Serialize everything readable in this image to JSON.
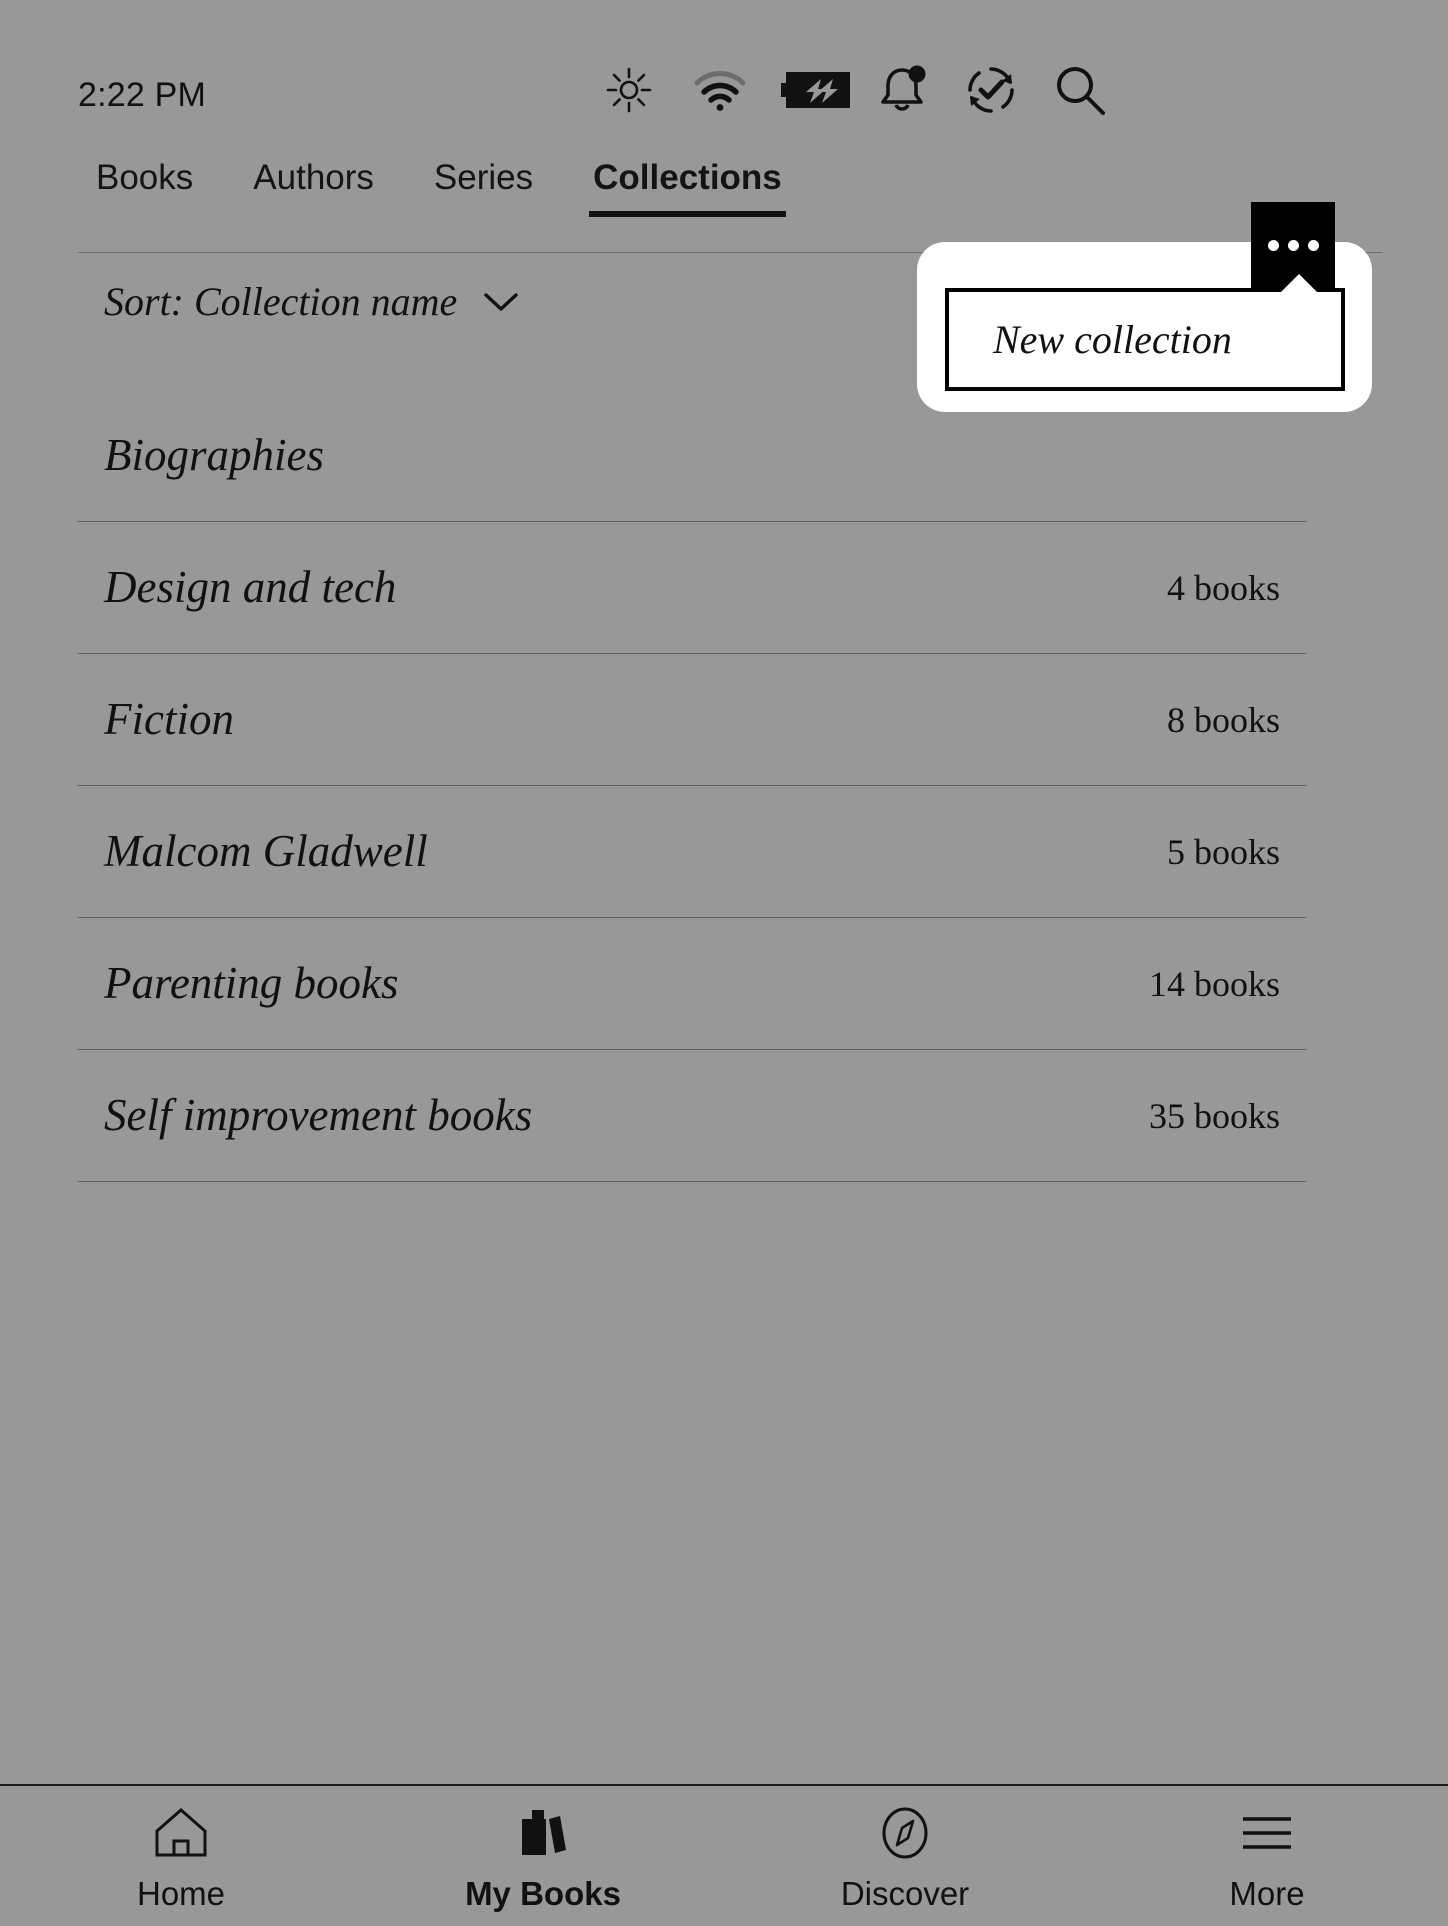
{
  "status_bar": {
    "time": "2:22 PM",
    "icons": [
      {
        "name": "brightness-icon",
        "label": "Brightness"
      },
      {
        "name": "wifi-icon",
        "label": "Wi-Fi"
      },
      {
        "name": "battery-charging-icon",
        "label": "Battery charging"
      },
      {
        "name": "notification-bell-icon",
        "label": "Notifications"
      },
      {
        "name": "sync-icon",
        "label": "Sync"
      },
      {
        "name": "search-icon",
        "label": "Search"
      }
    ]
  },
  "tabs": [
    {
      "label": "Books",
      "active": false
    },
    {
      "label": "Authors",
      "active": false
    },
    {
      "label": "Series",
      "active": false
    },
    {
      "label": "Collections",
      "active": true
    }
  ],
  "sort": {
    "label": "Sort: Collection name",
    "chevron": "chevron-down-icon"
  },
  "collections": [
    {
      "name": "Biographies",
      "count": ""
    },
    {
      "name": "Design and tech",
      "count": "4 books"
    },
    {
      "name": "Fiction",
      "count": "8 books"
    },
    {
      "name": "Malcom Gladwell",
      "count": "5 books"
    },
    {
      "name": "Parenting books",
      "count": "14 books"
    },
    {
      "name": "Self improvement books",
      "count": "35 books"
    }
  ],
  "popup": {
    "more_button": "more-options-icon",
    "menu_item": "New collection"
  },
  "bottom_nav": [
    {
      "label": "Home",
      "icon": "home-icon",
      "active": false
    },
    {
      "label": "My Books",
      "icon": "books-icon",
      "active": true
    },
    {
      "label": "Discover",
      "icon": "compass-icon",
      "active": false
    },
    {
      "label": "More",
      "icon": "hamburger-icon",
      "active": false
    }
  ],
  "colors": {
    "background": "#989898",
    "foreground": "#111111",
    "popup_background": "#ffffff",
    "accent": "#000000"
  }
}
